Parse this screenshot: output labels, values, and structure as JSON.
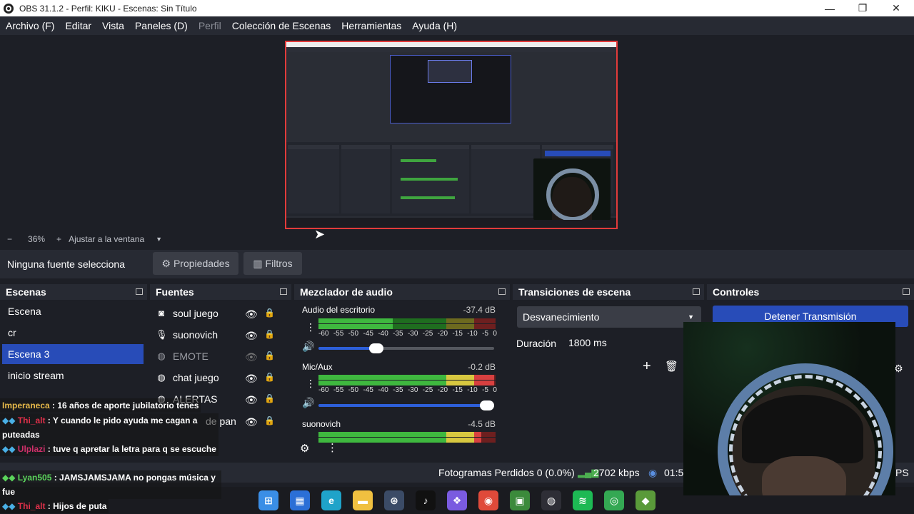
{
  "window": {
    "title": "OBS 31.1.2 - Perfil: KIKU - Escenas: Sin Título",
    "minimize": "—",
    "maximize": "❐",
    "close": "✕"
  },
  "menu": [
    "Archivo (F)",
    "Editar",
    "Vista",
    "Paneles (D)",
    "Perfil",
    "Colección de Escenas",
    "Herramientas",
    "Ayuda (H)"
  ],
  "zoom": {
    "minus": "−",
    "value": "36%",
    "plus": "+",
    "fit": "Ajustar a la ventana"
  },
  "source_bar": {
    "selected": "Ninguna fuente selecciona",
    "properties": "Propiedades",
    "filters": "Filtros"
  },
  "scenes": {
    "title": "Escenas",
    "items": [
      "Escena",
      "cr",
      "Escena 3",
      "inicio stream"
    ],
    "selected_index": 2
  },
  "sources": {
    "title": "Fuentes",
    "items": [
      {
        "label": "soul juego",
        "icon": "camera-icon"
      },
      {
        "label": "suonovich",
        "icon": "microphone-icon"
      },
      {
        "label": "EMOTE",
        "icon": "globe-icon"
      },
      {
        "label": "chat juego",
        "icon": "globe-icon"
      },
      {
        "label": "ALERTAS",
        "icon": "globe-icon"
      },
      {
        "label": "de pan",
        "icon": "image-icon"
      }
    ]
  },
  "mixer": {
    "title": "Mezclador de audio",
    "tracks": [
      {
        "name": "Audio del escritorio",
        "db": "-37.4 dB",
        "level": 0.42,
        "volume": 0.33
      },
      {
        "name": "Mic/Aux",
        "db": "-0.2 dB",
        "level": 0.99,
        "volume": 0.96
      },
      {
        "name": "suonovich",
        "db": "-4.5 dB",
        "level": 0.92,
        "volume": 0.9
      }
    ],
    "ticks": [
      "-60",
      "-55",
      "-50",
      "-45",
      "-40",
      "-35",
      "-30",
      "-25",
      "-20",
      "-15",
      "-10",
      "-5",
      "0"
    ]
  },
  "transitions": {
    "title": "Transiciones de escena",
    "current": "Desvanecimiento",
    "duration_label": "Duración",
    "duration_value": "1800 ms"
  },
  "controls": {
    "title": "Controles",
    "stop_stream": "Detener Transmisión"
  },
  "status": {
    "dropped": "Fotogramas Perdidos 0 (0.0%)",
    "bitrate": "2702 kbps",
    "time": "01:5",
    "fps_tail": "PS"
  },
  "chat": [
    {
      "user": "Imperaneca",
      "text": " : 16 años de aporte jubilatorio tenes",
      "color": "#e6b94a"
    },
    {
      "user": "Thi_alt",
      "text": " : Y cuando le pido ayuda me cagan a puteadas",
      "color": "#e0304a"
    },
    {
      "user": "Ulplazi",
      "text": " : tuve q apretar la letra para q se escuche",
      "color": "#d0306a"
    },
    {
      "user": "Lyan505",
      "text": " : JAMSJAMSJAMA no pongas música y fue",
      "color": "#5bd45b"
    },
    {
      "user": "Thi_alt",
      "text": " : Hijos de puta",
      "color": "#e0304a"
    }
  ],
  "taskbar": [
    {
      "name": "windows-start-icon",
      "color": "#3a8ee6"
    },
    {
      "name": "store-icon",
      "color": "#2b6fd6"
    },
    {
      "name": "edge-icon",
      "color": "#1fa3c9"
    },
    {
      "name": "folder-icon",
      "color": "#f0c040"
    },
    {
      "name": "steam-icon",
      "color": "#3b4b66"
    },
    {
      "name": "tiktok-icon",
      "color": "#111111"
    },
    {
      "name": "copilot-icon",
      "color": "#7a5be0"
    },
    {
      "name": "chrome-icon",
      "color": "#e04a3a"
    },
    {
      "name": "minecraft-icon",
      "color": "#3b8a3b"
    },
    {
      "name": "obs-icon",
      "color": "#2e2e36"
    },
    {
      "name": "spotify-icon",
      "color": "#1db954"
    },
    {
      "name": "chrome-alt-icon",
      "color": "#34a853"
    },
    {
      "name": "minecraft-block-icon",
      "color": "#5a9a3a"
    }
  ]
}
